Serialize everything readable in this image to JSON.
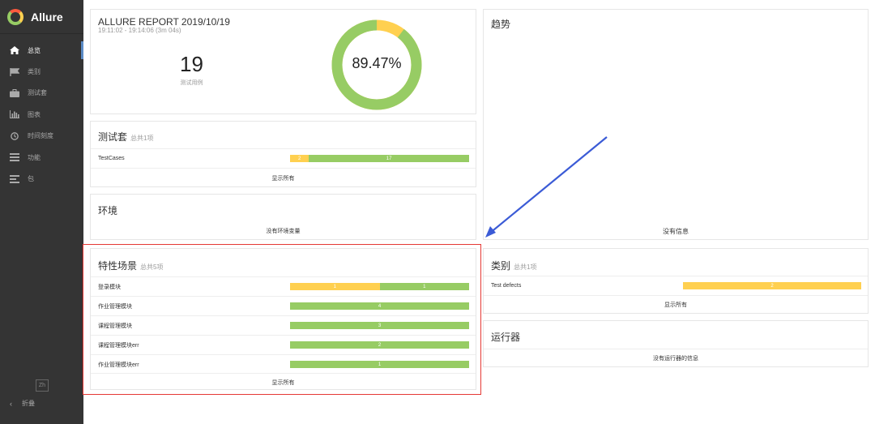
{
  "sidebar": {
    "brand": "Allure",
    "items": [
      {
        "label": "总览",
        "icon": "home-icon",
        "active": true
      },
      {
        "label": "类别",
        "icon": "flag-icon",
        "active": false
      },
      {
        "label": "测试套",
        "icon": "briefcase-icon",
        "active": false
      },
      {
        "label": "图表",
        "icon": "bar-chart-icon",
        "active": false
      },
      {
        "label": "时间刻度",
        "icon": "clock-icon",
        "active": false
      },
      {
        "label": "功能",
        "icon": "list-icon",
        "active": false
      },
      {
        "label": "包",
        "icon": "align-left-icon",
        "active": false
      }
    ],
    "language": "Zh",
    "collapse": "折叠"
  },
  "summary": {
    "title": "ALLURE REPORT 2019/10/19",
    "time": "19:11:02 - 19:14:06 (3m 04s)",
    "count": "19",
    "count_label": "测试用例",
    "percent": "89.47%",
    "passed_fraction": 0.8947,
    "colors": {
      "passed": "#97cc64",
      "broken": "#ffd050"
    }
  },
  "suites": {
    "title": "测试套",
    "subtitle": "总共1项",
    "rows": [
      {
        "name": "TestCases",
        "broken": 2,
        "passed": 17
      }
    ],
    "show_all": "显示所有"
  },
  "environment": {
    "title": "环境",
    "empty": "没有环境变量"
  },
  "features": {
    "title": "特性场景",
    "subtitle": "总共5项",
    "rows": [
      {
        "name": "登录模块",
        "broken": 1,
        "passed": 1
      },
      {
        "name": "作业管理模块",
        "broken": 0,
        "passed": 4
      },
      {
        "name": "课程管理模块",
        "broken": 0,
        "passed": 3
      },
      {
        "name": "课程管理模块err",
        "broken": 0,
        "passed": 2
      },
      {
        "name": "作业管理模块err",
        "broken": 0,
        "passed": 1
      }
    ],
    "show_all": "显示所有"
  },
  "trend": {
    "title": "趋势",
    "empty": "没有信息"
  },
  "categories": {
    "title": "类别",
    "subtitle": "总共1项",
    "rows": [
      {
        "name": "Test defects",
        "value": 2
      }
    ],
    "show_all": "显示所有"
  },
  "executors": {
    "title": "运行器",
    "empty": "没有运行器的信息"
  }
}
